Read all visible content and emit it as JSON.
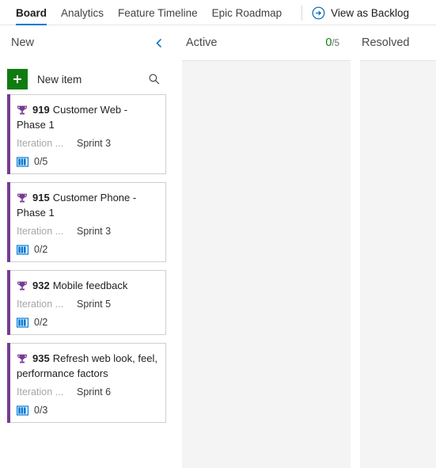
{
  "nav": {
    "tabs": [
      {
        "label": "Board",
        "active": true
      },
      {
        "label": "Analytics",
        "active": false
      },
      {
        "label": "Feature Timeline",
        "active": false
      },
      {
        "label": "Epic Roadmap",
        "active": false
      }
    ],
    "action": {
      "label": "View as Backlog",
      "icon": "arrow-circle-right-icon"
    }
  },
  "toolbar": {
    "new_item_label": "New item",
    "new_item_icon": "plus-icon",
    "search_icon": "search-icon"
  },
  "columns": [
    {
      "name": "new",
      "title": "New",
      "collapse_icon": "chevron-left-icon",
      "count": null,
      "limit": null
    },
    {
      "name": "active",
      "title": "Active",
      "count": "0",
      "limit": "/5"
    },
    {
      "name": "resolved",
      "title": "Resolved",
      "count": null,
      "limit": null
    }
  ],
  "cards": [
    {
      "id": "919",
      "title": "Customer Web - Phase 1",
      "type_icon": "trophy-icon",
      "field_label": "Iteration ...",
      "field_value": "Sprint 3",
      "progress_icon": "backlog-book-icon",
      "progress": "0/5"
    },
    {
      "id": "915",
      "title": "Customer Phone - Phase 1",
      "type_icon": "trophy-icon",
      "field_label": "Iteration ...",
      "field_value": "Sprint 3",
      "progress_icon": "backlog-book-icon",
      "progress": "0/2"
    },
    {
      "id": "932",
      "title": "Mobile feedback",
      "type_icon": "trophy-icon",
      "field_label": "Iteration ...",
      "field_value": "Sprint 5",
      "progress_icon": "backlog-book-icon",
      "progress": "0/2"
    },
    {
      "id": "935",
      "title": "Refresh web look, feel, performance factors",
      "type_icon": "trophy-icon",
      "field_label": "Iteration ...",
      "field_value": "Sprint 6",
      "progress_icon": "backlog-book-icon",
      "progress": "0/3"
    }
  ],
  "colors": {
    "accent": "#0078d4",
    "epic_purple": "#773b93",
    "green": "#107c10",
    "column_body": "#f4f4f4"
  }
}
